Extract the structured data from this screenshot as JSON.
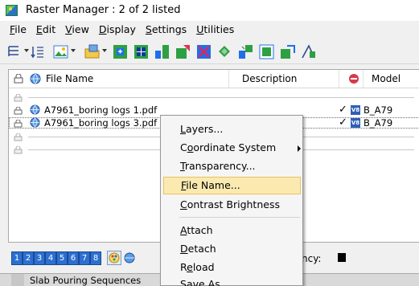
{
  "window": {
    "title": "Raster Manager : 2 of 2 listed"
  },
  "menubar": {
    "items": [
      {
        "mnemonic": "F",
        "rest": "ile"
      },
      {
        "mnemonic": "E",
        "rest": "dit"
      },
      {
        "mnemonic": "V",
        "rest": "iew"
      },
      {
        "mnemonic": "D",
        "rest": "isplay"
      },
      {
        "mnemonic": "S",
        "rest": "ettings"
      },
      {
        "mnemonic": "U",
        "rest": "tilities"
      }
    ]
  },
  "list": {
    "columns": {
      "file_name": "File Name",
      "description": "Description",
      "model": "Model"
    },
    "rows": [
      {
        "file": "A7961_boring logs 1.pdf",
        "check": "✓",
        "model_badge": "V8",
        "model": "B_A79"
      },
      {
        "file": "A7961_boring logs 3.pdf",
        "check": "✓",
        "model_badge": "V8",
        "model": "B_A79"
      }
    ]
  },
  "bottom": {
    "views": [
      "1",
      "2",
      "3",
      "4",
      "5",
      "6",
      "7",
      "8"
    ],
    "opacity_label": "ncy:"
  },
  "below": {
    "text": "Slab Pouring Sequences"
  },
  "context_menu": {
    "items": [
      {
        "prefix": "",
        "mnemonic": "L",
        "rest": "ayers..."
      },
      {
        "prefix": "C",
        "mnemonic": "o",
        "rest": "ordinate System"
      },
      {
        "prefix": "",
        "mnemonic": "T",
        "rest": "ransparency..."
      },
      {
        "prefix": "",
        "mnemonic": "F",
        "rest": "ile Name..."
      },
      {
        "prefix": "",
        "mnemonic": "C",
        "rest": "ontrast Brightness"
      },
      {
        "prefix": "",
        "mnemonic": "A",
        "rest": "ttach"
      },
      {
        "prefix": "",
        "mnemonic": "D",
        "rest": "etach"
      },
      {
        "prefix": "R",
        "mnemonic": "e",
        "rest": "load"
      },
      {
        "prefix": "",
        "mnemonic": "S",
        "rest": "ave As..."
      }
    ]
  }
}
